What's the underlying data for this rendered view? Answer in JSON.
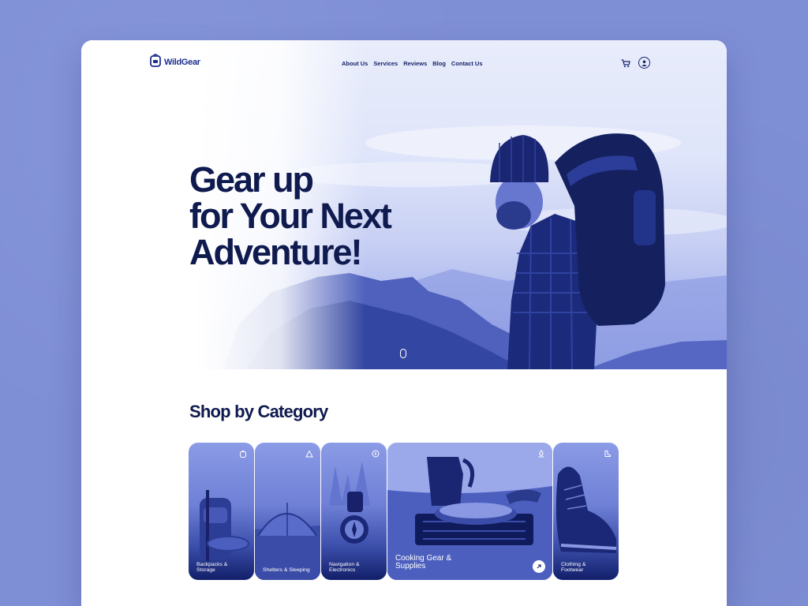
{
  "brand": {
    "name": "WildGear"
  },
  "nav": {
    "items": [
      "About Us",
      "Services",
      "Reviews",
      "Blog",
      "Contact Us"
    ]
  },
  "hero": {
    "title_lines": [
      "Gear up",
      "for Your Next",
      "Adventure!"
    ]
  },
  "categories_section": {
    "title": "Shop by Category",
    "items": [
      {
        "label": "Backpacks & Storage",
        "icon": "backpack-icon"
      },
      {
        "label": "Shelters & Sleeping",
        "icon": "tent-icon"
      },
      {
        "label": "Navigation & Electronics",
        "icon": "compass-icon"
      },
      {
        "label": "Cooking Gear & Supplies",
        "icon": "campfire-icon"
      },
      {
        "label": "Clothing & Footwear",
        "icon": "boot-icon"
      }
    ]
  },
  "colors": {
    "background": "#7f8fd6",
    "primary_text": "#0f1a4e",
    "accent": "#1d2f8f"
  }
}
